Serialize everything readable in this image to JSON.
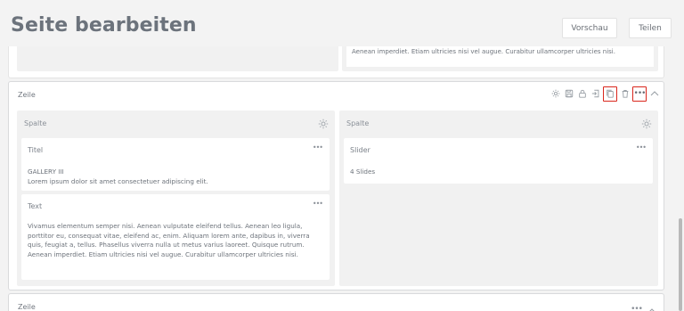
{
  "header": {
    "title": "Seite bearbeiten",
    "preview_label": "Vorschau",
    "share_label": "Teilen"
  },
  "previous_row": {
    "text_tail": "Aenean imperdiet. Etiam ultricies nisi vel augue. Curabitur ullamcorper ultricies nisi."
  },
  "row": {
    "label": "Zeile",
    "tools": [
      "gear-icon",
      "save-icon",
      "lock-icon",
      "import-icon",
      "copy-icon",
      "trash-icon",
      "more-icon",
      "chevron-up-icon"
    ],
    "highlighted_tools": [
      "copy-icon",
      "more-icon"
    ],
    "more_label": "•••",
    "columns": [
      {
        "label": "Spalte",
        "cards": [
          {
            "type": "Titel",
            "more": "•••",
            "lines": [
              "GALLERY III",
              "Lorem ipsum dolor sit amet consectetuer adipiscing elit."
            ]
          },
          {
            "type": "Text",
            "more": "•••",
            "lines": [
              "Vivamus elementum semper nisi. Aenean vulputate eleifend tellus. Aenean leo ligula,",
              "porttitor eu, consequat vitae, eleifend ac, enim. Aliquam lorem ante, dapibus in, viverra",
              "quis, feugiat a, tellus. Phasellus viverra nulla ut metus varius laoreet. Quisque rutrum.",
              "Aenean imperdiet. Etiam ultricies nisi vel augue. Curabitur ullamcorper ultricies nisi."
            ]
          }
        ]
      },
      {
        "label": "Spalte",
        "cards": [
          {
            "type": "Slider",
            "more": "•••",
            "lines": [
              "4 Slides"
            ]
          }
        ]
      }
    ]
  },
  "next_row": {
    "label": "Zeile",
    "more_label": "•••"
  },
  "colors": {
    "background": "#f3f3f3",
    "highlight_red": "#d9261c",
    "column_bg": "#f1f1f1"
  }
}
